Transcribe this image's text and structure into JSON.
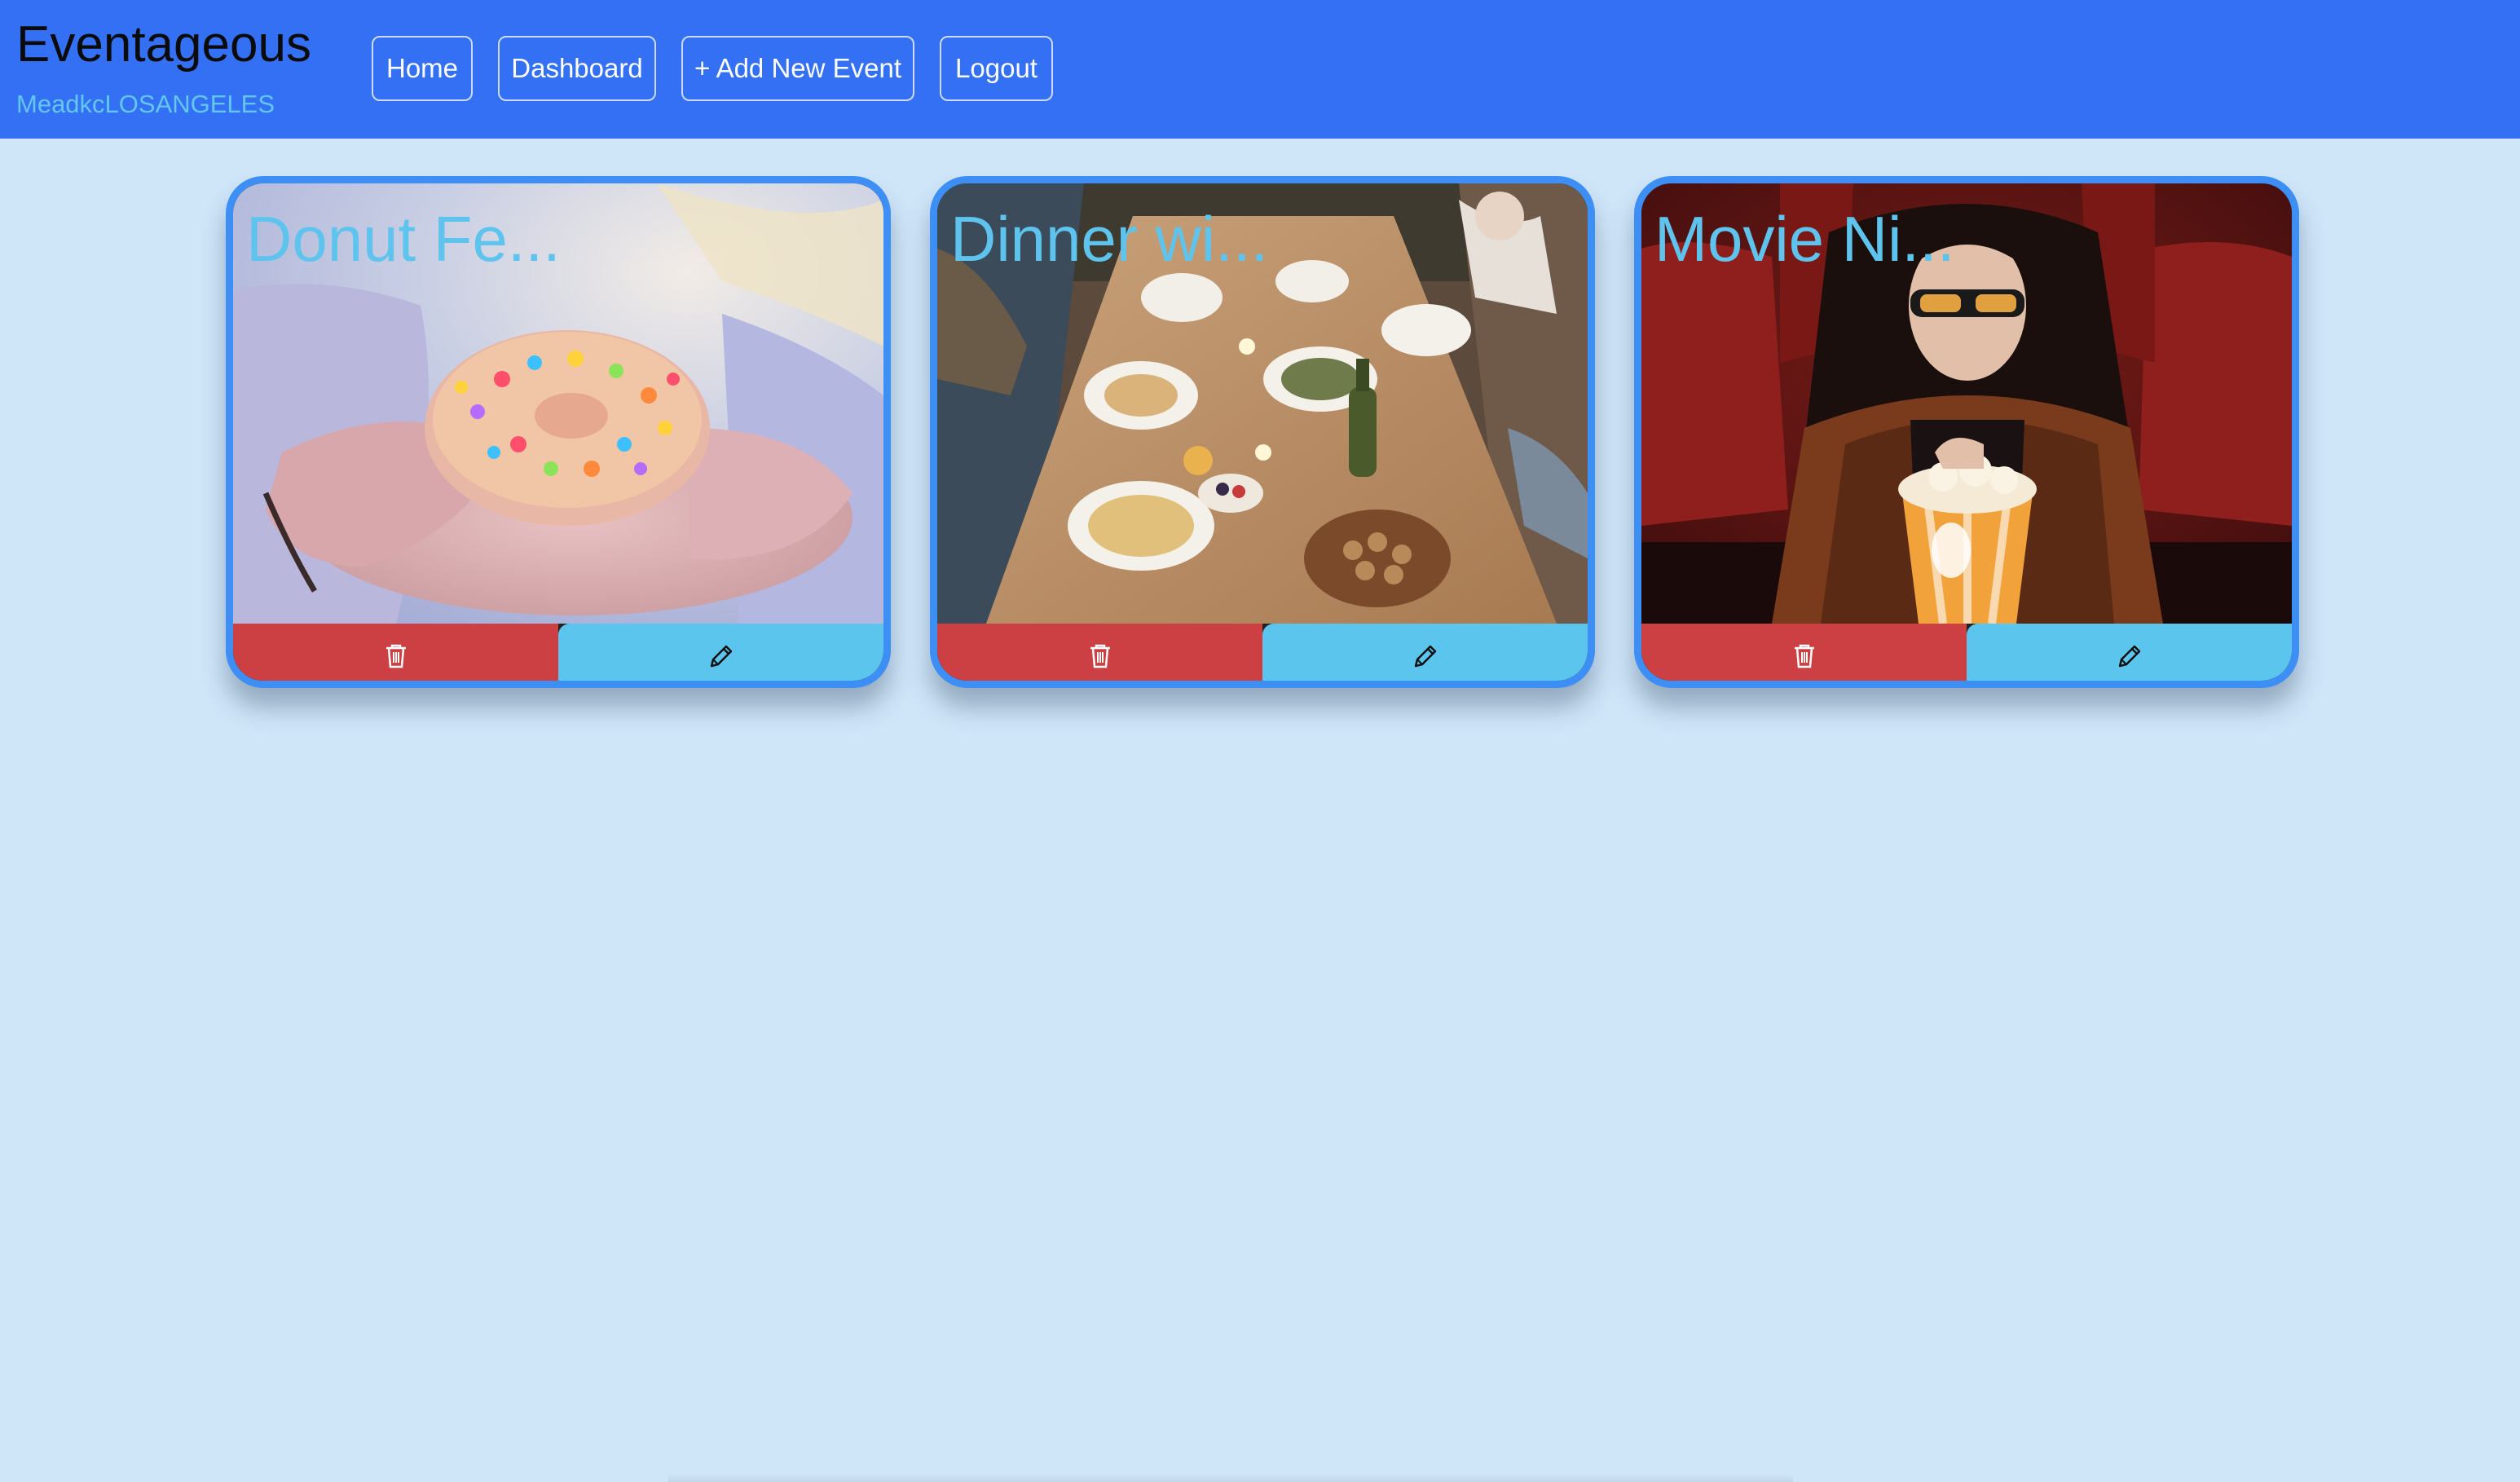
{
  "app": {
    "brand": "Eventageous",
    "username": "MeadkcLOSANGELES"
  },
  "nav": {
    "items": [
      {
        "label": "Home"
      },
      {
        "label": "Dashboard"
      },
      {
        "label": "+ Add New Event"
      },
      {
        "label": "Logout"
      }
    ]
  },
  "events": [
    {
      "title": "Donut Fe...",
      "image": "donut-photo"
    },
    {
      "title": "Dinner wi...",
      "image": "dinner-table-photo"
    },
    {
      "title": "Movie Ni...",
      "image": "movie-theater-photo"
    }
  ],
  "colors": {
    "navbar": "#3470f4",
    "page_background": "#cfe6f9",
    "card_border": "#3d8ef5",
    "title_text": "#5ec4ee",
    "delete_button": "#cc4044",
    "edit_button": "#5cc5ee",
    "username_text": "#62c6f0"
  },
  "icons": {
    "delete": "trash-icon",
    "edit": "pencil-icon"
  }
}
